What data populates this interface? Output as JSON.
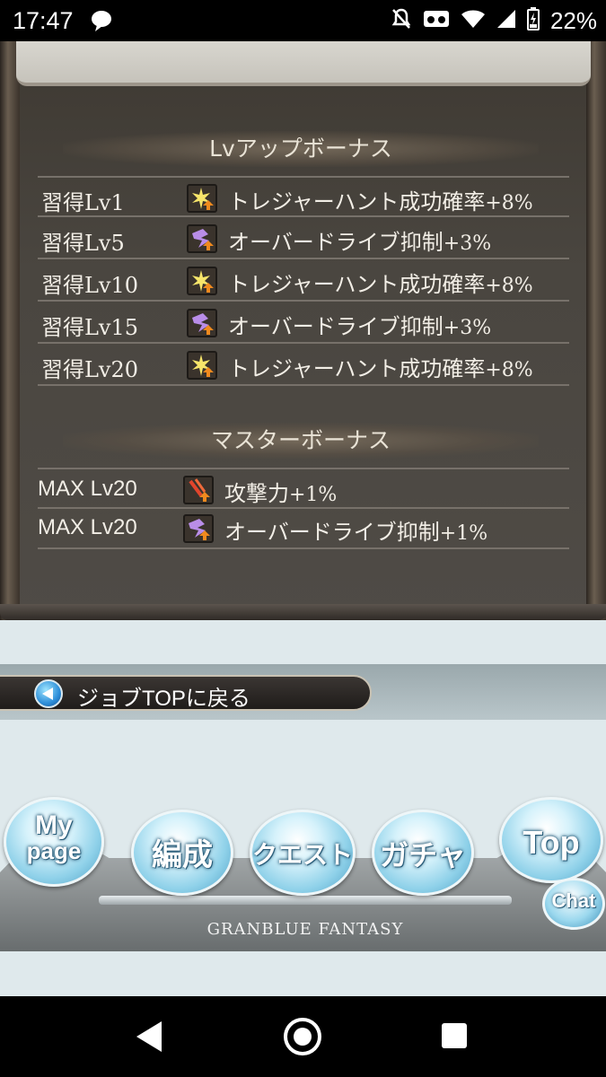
{
  "status_bar": {
    "time": "17:47",
    "battery": "22%",
    "icons": [
      "chat-bubble-icon",
      "notifications-off-icon",
      "vr-icon",
      "wifi-icon",
      "signal-icon",
      "battery-charging-icon"
    ]
  },
  "lv_up_bonus": {
    "title": "Lvアップボーナス",
    "rows": [
      {
        "level": "習得Lv1",
        "icon": "treasure-hunt-icon",
        "name": "トレジャーハント成功確率",
        "value": "+8%"
      },
      {
        "level": "習得Lv5",
        "icon": "overdrive-icon",
        "name": "オーバードライブ抑制",
        "value": "+3%"
      },
      {
        "level": "習得Lv10",
        "icon": "treasure-hunt-icon",
        "name": "トレジャーハント成功確率",
        "value": "+8%"
      },
      {
        "level": "習得Lv15",
        "icon": "overdrive-icon",
        "name": "オーバードライブ抑制",
        "value": "+3%"
      },
      {
        "level": "習得Lv20",
        "icon": "treasure-hunt-icon",
        "name": "トレジャーハント成功確率",
        "value": "+8%"
      }
    ]
  },
  "master_bonus": {
    "title": "マスターボーナス",
    "rows": [
      {
        "level": "MAX Lv20",
        "icon": "attack-icon",
        "name": "攻撃力",
        "value": "+1%"
      },
      {
        "level": "MAX Lv20",
        "icon": "overdrive-icon",
        "name": "オーバードライブ抑制",
        "value": "+1%"
      }
    ]
  },
  "back_button": {
    "label": "ジョブTOPに戻る"
  },
  "nav": {
    "mypage_line1": "My",
    "mypage_line2": "page",
    "party": "編成",
    "quest": "クエスト",
    "gacha": "ガチャ",
    "top": "Top",
    "chat": "Chat",
    "logo": "GRANBLUE FANTASY"
  },
  "colors": {
    "panel_bg": "#4a4640",
    "text": "#f2eee6",
    "bubble": "#8fd1e9",
    "accent_blue": "#2d8ed9"
  }
}
